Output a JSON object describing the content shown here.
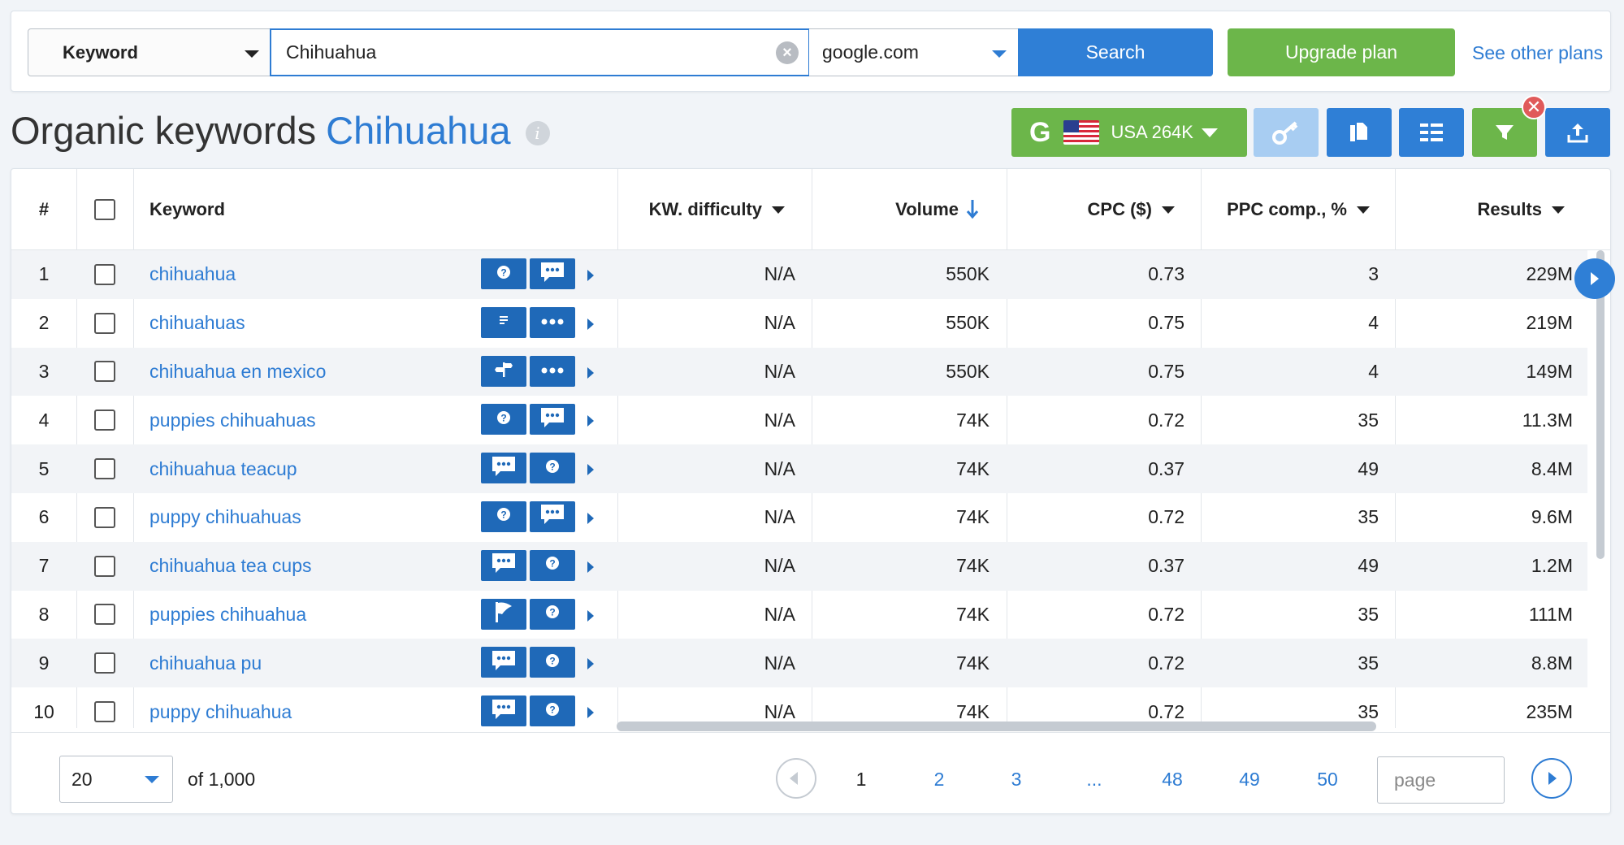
{
  "search": {
    "type_label": "Keyword",
    "query": "Chihuahua",
    "database": "google.com",
    "search_label": "Search",
    "upgrade_label": "Upgrade plan",
    "other_plans_label": "See other plans"
  },
  "title": {
    "prefix": "Organic keywords",
    "keyword": "Chihuahua",
    "info_glyph": "i"
  },
  "toolbar": {
    "engine_glyph": "G",
    "country_label": "USA 264K",
    "remove_glyph": "✕"
  },
  "table": {
    "columns": {
      "num": "#",
      "keyword": "Keyword",
      "kw_difficulty": "KW. difficulty",
      "volume": "Volume",
      "cpc": "CPC ($)",
      "ppc": "PPC comp., %",
      "results": "Results"
    },
    "rows": [
      {
        "n": "1",
        "keyword": "chihuahua",
        "features": [
          "question-icon",
          "comment-icon"
        ],
        "kd": "N/A",
        "volume": "550K",
        "cpc": "0.73",
        "ppc": "3",
        "results": "229M"
      },
      {
        "n": "2",
        "keyword": "chihuahuas",
        "features": [
          "list-icon",
          "more-icon"
        ],
        "kd": "N/A",
        "volume": "550K",
        "cpc": "0.75",
        "ppc": "4",
        "results": "219M"
      },
      {
        "n": "3",
        "keyword": "chihuahua en mexico",
        "features": [
          "signpost-icon",
          "more-icon"
        ],
        "kd": "N/A",
        "volume": "550K",
        "cpc": "0.75",
        "ppc": "4",
        "results": "149M"
      },
      {
        "n": "4",
        "keyword": "puppies chihuahuas",
        "features": [
          "question-icon",
          "comment-icon"
        ],
        "kd": "N/A",
        "volume": "74K",
        "cpc": "0.72",
        "ppc": "35",
        "results": "11.3M"
      },
      {
        "n": "5",
        "keyword": "chihuahua teacup",
        "features": [
          "comment-icon",
          "question-icon"
        ],
        "kd": "N/A",
        "volume": "74K",
        "cpc": "0.37",
        "ppc": "49",
        "results": "8.4M"
      },
      {
        "n": "6",
        "keyword": "puppy chihuahuas",
        "features": [
          "question-icon",
          "comment-icon"
        ],
        "kd": "N/A",
        "volume": "74K",
        "cpc": "0.72",
        "ppc": "35",
        "results": "9.6M"
      },
      {
        "n": "7",
        "keyword": "chihuahua tea cups",
        "features": [
          "comment-icon",
          "question-icon"
        ],
        "kd": "N/A",
        "volume": "74K",
        "cpc": "0.37",
        "ppc": "49",
        "results": "1.2M"
      },
      {
        "n": "8",
        "keyword": "puppies chihuahua",
        "features": [
          "flag-icon",
          "question-icon"
        ],
        "kd": "N/A",
        "volume": "74K",
        "cpc": "0.72",
        "ppc": "35",
        "results": "111M"
      },
      {
        "n": "9",
        "keyword": "chihuahua pu",
        "features": [
          "comment-icon",
          "question-icon"
        ],
        "kd": "N/A",
        "volume": "74K",
        "cpc": "0.72",
        "ppc": "35",
        "results": "8.8M"
      },
      {
        "n": "10",
        "keyword": "puppy chihuahua",
        "features": [
          "comment-icon",
          "question-icon"
        ],
        "kd": "N/A",
        "volume": "74K",
        "cpc": "0.72",
        "ppc": "35",
        "results": "235M"
      }
    ]
  },
  "pagination": {
    "per_page": "20",
    "total": "of 1,000",
    "pages": [
      "1",
      "2",
      "3",
      "...",
      "48",
      "49",
      "50"
    ],
    "current": "1",
    "page_placeholder": "page"
  },
  "colors": {
    "accent": "#2e7cd3",
    "feature_bg": "#1f69b8",
    "green": "#6cb64a"
  }
}
